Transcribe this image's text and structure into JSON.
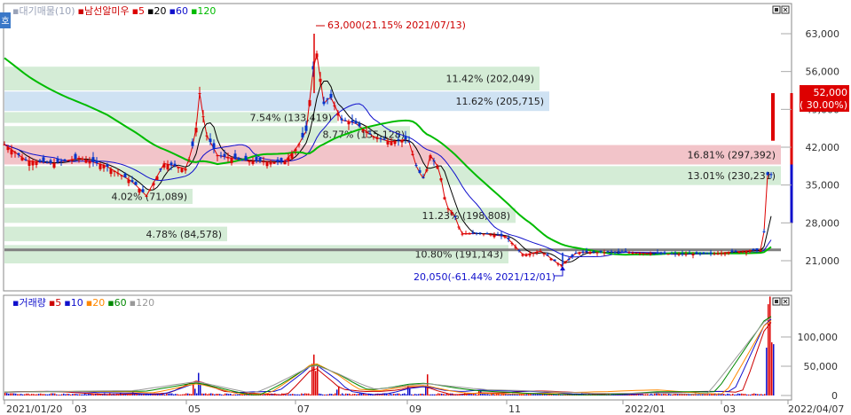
{
  "price_panel": {
    "legend": [
      {
        "text": "대기매물(10)",
        "color": "#9aa3b8"
      },
      {
        "text": "남선알미우",
        "color": "#cc0000"
      },
      {
        "text": "5",
        "color": "#dd0000"
      },
      {
        "text": "20",
        "color": "#000000"
      },
      {
        "text": "60",
        "color": "#1010cc"
      },
      {
        "text": "120",
        "color": "#00bb00"
      }
    ],
    "side_tab": "호",
    "y_ticks": [
      "63,000",
      "56,000",
      "49,000",
      "42,000",
      "35,000",
      "28,000",
      "21,000"
    ],
    "current_price": "52,000",
    "current_change": "( 30.00%)",
    "max_annotation": "63,000(21.15% 2021/07/13)",
    "min_annotation": "20,050(-61.44% 2021/12/01)"
  },
  "volume_panel": {
    "legend": [
      {
        "text": "거래량",
        "color": "#1010cc"
      },
      {
        "text": "5",
        "color": "#cc0000"
      },
      {
        "text": "10",
        "color": "#1010cc"
      },
      {
        "text": "20",
        "color": "#ff8800"
      },
      {
        "text": "60",
        "color": "#008800"
      },
      {
        "text": "120",
        "color": "#999999"
      }
    ],
    "y_ticks": [
      "100,000",
      "50,000",
      "0"
    ]
  },
  "x_axis_labels": [
    "2021/01/20",
    "03",
    "05",
    "07",
    "09",
    "11",
    "2022/01",
    "03",
    "2022/04/07"
  ],
  "chart_data": {
    "type": "candlestick",
    "price_axis": {
      "ticks": [
        63000,
        56000,
        49000,
        42000,
        35000,
        28000,
        21000
      ]
    },
    "volume_axis": {
      "ticks": [
        100000,
        50000,
        0
      ]
    },
    "overhang_bands": [
      {
        "label": "11.42% (202,049)",
        "low": 52500,
        "high": 56900,
        "highlight": "none"
      },
      {
        "label": "11.62% (205,715)",
        "low": 48700,
        "high": 52300,
        "highlight": "blue"
      },
      {
        "label": "7.54% (133,419)",
        "low": 46500,
        "high": 48500,
        "highlight": "none"
      },
      {
        "label": "8.77% (155,128)",
        "low": 42800,
        "high": 45900,
        "highlight": "none"
      },
      {
        "label": "16.81% (297,392)",
        "low": 38800,
        "high": 42400,
        "highlight": "red"
      },
      {
        "label": "13.01% (230,231)",
        "low": 35000,
        "high": 38500,
        "highlight": "none"
      },
      {
        "label": "4.02% (71,089)",
        "low": 31500,
        "high": 34300,
        "highlight": "none"
      },
      {
        "label": "11.23% (198,808)",
        "low": 28000,
        "high": 30800,
        "highlight": "none"
      },
      {
        "label": "4.78% (84,578)",
        "low": 24600,
        "high": 27300,
        "highlight": "none"
      },
      {
        "label": "10.80% (191,143)",
        "low": 20500,
        "high": 23900,
        "highlight": "none"
      }
    ],
    "reference_line": 23000,
    "annotations": [
      {
        "text": "63,000(21.15% 2021/07/13)",
        "value": 63000,
        "date": "2021/07/13"
      },
      {
        "text": "20,050(-61.44% 2021/12/01)",
        "value": 20050,
        "date": "2021/12/01"
      }
    ],
    "price_series": [
      {
        "name": "5",
        "color": "#dd0000"
      },
      {
        "name": "20",
        "color": "#000000"
      },
      {
        "name": "60",
        "color": "#1010cc"
      },
      {
        "name": "120",
        "color": "#00bb00"
      }
    ]
  }
}
